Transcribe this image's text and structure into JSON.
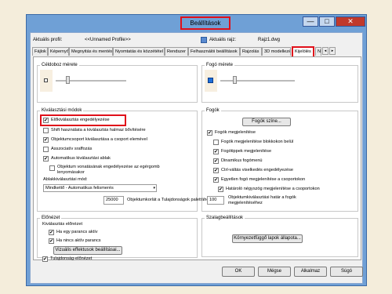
{
  "window": {
    "title": "Beállítások",
    "min_label": "—",
    "max_label": "□",
    "close_label": "✕"
  },
  "profile": {
    "current_label": "Aktuális profil:",
    "current_value": "<<Unnamed Profile>>",
    "drawing_label": "Aktuális rajz:",
    "drawing_value": "Rajz1.dwg"
  },
  "tabs": [
    "Fájlok",
    "Képernyő",
    "Megnyitás és mentés",
    "Nyomtatás és közzététel",
    "Rendszer",
    "Felhasználói beállítások",
    "Rajzolás",
    "3D modellezés",
    "Kijelölés",
    "N"
  ],
  "left": {
    "pickbox": {
      "title": "Céldoboz mérete"
    },
    "modes": {
      "title": "Kiválasztási módok",
      "items": [
        {
          "label": "Előkiválasztás engedélyezése",
          "checked": true
        },
        {
          "label": "Shift használata a kiválasztás halmaz bővítésére",
          "checked": false
        },
        {
          "label": "Objektumcsoport kiválasztása a csoport elemével",
          "checked": true
        },
        {
          "label": "Asszociatív sraffozás",
          "checked": false
        },
        {
          "label": "Automatikus kiválasztási ablak",
          "checked": true
        },
        {
          "label": "Objektum vonatásának engedélyezése az egérgomb lenyomásakor",
          "checked": false
        }
      ],
      "window_mode_label": "Ablakkiválasztási mód:",
      "window_mode_value": "Mindkettő - Automatikus felismerés",
      "limit_value": "25000",
      "limit_label": "Objektumkorlát a Tulajdonságok palettához"
    },
    "preview": {
      "title": "Előnézet",
      "subtitle": "Kiválasztás előnézet",
      "items": [
        {
          "label": "Ha egy parancs aktív",
          "checked": true
        },
        {
          "label": "Ha nincs aktív parancs",
          "checked": true
        }
      ],
      "visual_button": "Vizuális effektusok beállításai...",
      "props_label": "Tulajdonság-előnézet",
      "props_checked": true
    }
  },
  "right": {
    "grip_size": {
      "title": "Fogó mérete"
    },
    "grips": {
      "title": "Fogók",
      "color_button": "Fogók színe...",
      "items": [
        {
          "label": "Fogók megjelenítése",
          "checked": true
        },
        {
          "label": "Fogók megjelenítése blokkokon belül",
          "checked": false
        },
        {
          "label": "Fogótippek megjelenítése",
          "checked": true
        },
        {
          "label": "Dinamikus fogómenü",
          "checked": true
        },
        {
          "label": "Ctrl-váltás viselkedés engedélyezése",
          "checked": true
        },
        {
          "label": "Egyetlen fogó megjelenítése a csoportokon",
          "checked": true
        },
        {
          "label": "Határoló négyszög megjelenítése a csoportokon",
          "checked": true
        }
      ],
      "limit_value": "100",
      "limit_label_1": "Objektumkiválasztási határ a fogók",
      "limit_label_2": "megjelenítéséhez"
    },
    "ribbon": {
      "title": "Szalagbeállítások",
      "button": "Környezetfüggő lapok állapota..."
    }
  },
  "footer": {
    "ok": "OK",
    "cancel": "Mégse",
    "apply": "Alkalmaz",
    "help": "Súgó"
  },
  "check_mark": "✔"
}
